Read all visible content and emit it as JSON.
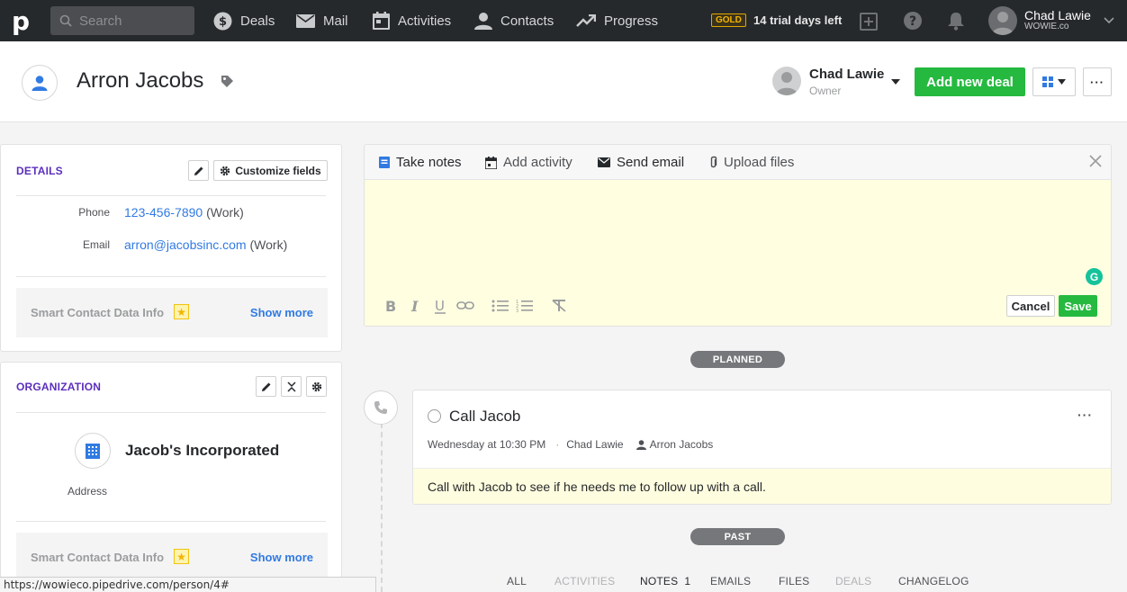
{
  "topnav": {
    "logo": "p",
    "search_placeholder": "Search",
    "items": [
      {
        "label": "Deals",
        "icon": "dollar-icon"
      },
      {
        "label": "Mail",
        "icon": "mail-icon"
      },
      {
        "label": "Activities",
        "icon": "calendar-icon"
      },
      {
        "label": "Contacts",
        "icon": "person-icon"
      },
      {
        "label": "Progress",
        "icon": "trend-icon"
      }
    ],
    "plan_badge": "GOLD",
    "trial_text": "14 trial days left",
    "user_name": "Chad Lawie",
    "user_org": "WOWIE.co"
  },
  "header": {
    "person_name": "Arron Jacobs",
    "owner_name": "Chad Lawie",
    "owner_label": "Owner",
    "add_deal_label": "Add new deal",
    "more_label": "···"
  },
  "details": {
    "title": "DETAILS",
    "customize_label": "Customize fields",
    "phone_label": "Phone",
    "phone_value": "123-456-7890",
    "phone_type": "(Work)",
    "email_label": "Email",
    "email_value": "arron@jacobsinc.com",
    "email_type": "(Work)",
    "smart_title": "Smart Contact Data Info",
    "smart_link": "Show more"
  },
  "organization": {
    "title": "ORGANIZATION",
    "name": "Jacob's Incorporated",
    "address_label": "Address",
    "smart_title": "Smart Contact Data Info",
    "smart_link": "Show more"
  },
  "composer": {
    "tabs": [
      "Take notes",
      "Add activity",
      "Send email",
      "Upload files"
    ],
    "cancel_label": "Cancel",
    "save_label": "Save"
  },
  "timeline": {
    "planned_label": "PLANNED",
    "past_label": "PAST",
    "activity": {
      "title": "Call Jacob",
      "when": "Wednesday at 10:30 PM",
      "owner": "Chad Lawie",
      "person": "Arron Jacobs",
      "note": "Call with Jacob to see if he needs me to follow up with a call.",
      "more": "···"
    },
    "filters": [
      {
        "label": "ALL"
      },
      {
        "label": "ACTIVITIES"
      },
      {
        "label": "NOTES",
        "count": "1"
      },
      {
        "label": "EMAILS"
      },
      {
        "label": "FILES"
      },
      {
        "label": "DEALS"
      },
      {
        "label": "CHANGELOG"
      }
    ]
  },
  "statusbar": {
    "url": "https://wowieco.pipedrive.com/person/4#"
  },
  "colors": {
    "accent_green": "#25b940",
    "link_blue": "#317ae2",
    "section_purple": "#5b2fbd",
    "nav_bg": "#26292c"
  }
}
